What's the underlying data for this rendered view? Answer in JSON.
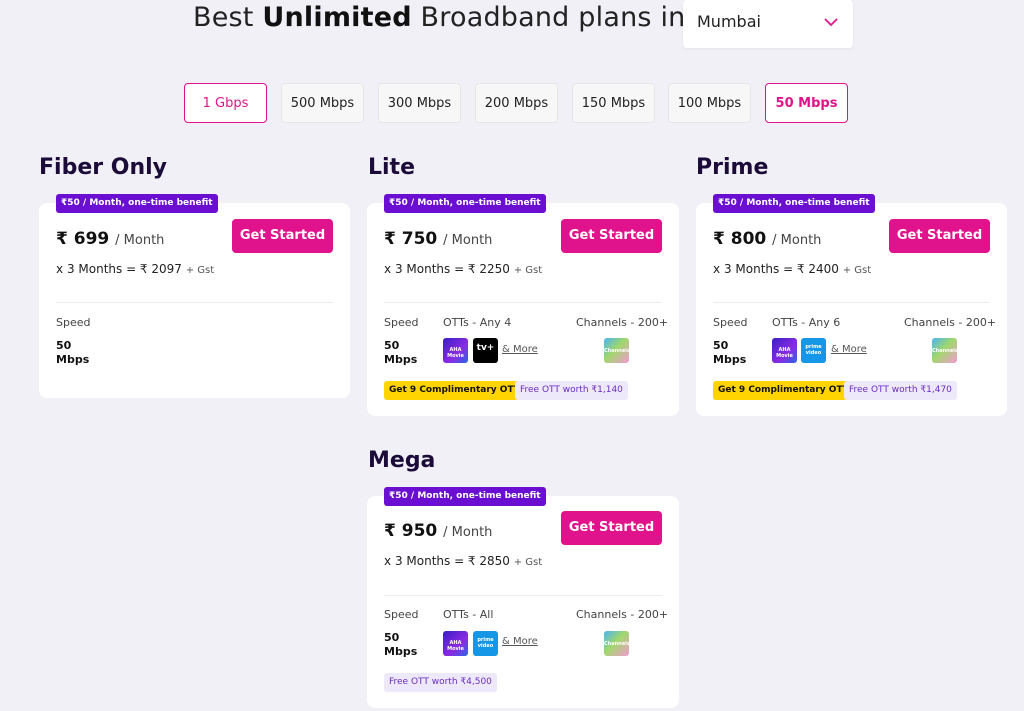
{
  "header": {
    "title_pre": "Best ",
    "title_bold": "Unlimited",
    "title_post": " Broadband plans in",
    "city": "Mumbai"
  },
  "speeds": [
    "1 Gbps",
    "500 Mbps",
    "300 Mbps",
    "200 Mbps",
    "150 Mbps",
    "100 Mbps",
    "50 Mbps"
  ],
  "selected_speed": "50 Mbps",
  "accent_color": "#e0138c",
  "benefit_color": "#6a0fd1",
  "plans": [
    {
      "name": "Fiber Only",
      "benefit": "₹50 / Month, one-time benefit",
      "price": "₹ 699",
      "per": "/ Month",
      "x": "x",
      "months": "3 Months = ₹ 2097",
      "gst": "+ Gst",
      "cta": "Get Started",
      "speed_label": "Speed",
      "speed_value": "50 Mbps"
    },
    {
      "name": "Lite",
      "benefit": "₹50 / Month, one-time benefit",
      "price": "₹ 750",
      "per": "/ Month",
      "x": "x",
      "months": "3 Months = ₹ 2250",
      "gst": "+ Gst",
      "cta": "Get Started",
      "speed_label": "Speed",
      "speed_value": "50 Mbps",
      "otts_label": "OTTs - Any 4",
      "channels_label": "Channels - 200+",
      "more": "& More",
      "ott_icons": [
        "aha-icon",
        "apple-tv-icon"
      ],
      "ott_icon_text": [
        "AHA Movie",
        "tv+"
      ],
      "channel_icon_text": "Channels",
      "pill_yellow": "Get 9 Complimentary OTTs",
      "pill_lilac": "Free OTT worth ₹1,140"
    },
    {
      "name": "Prime",
      "benefit": "₹50 / Month, one-time benefit",
      "price": "₹ 800",
      "per": "/ Month",
      "x": "x",
      "months": "3 Months = ₹ 2400",
      "gst": "+ Gst",
      "cta": "Get Started",
      "speed_label": "Speed",
      "speed_value": "50 Mbps",
      "otts_label": "OTTs - Any 6",
      "channels_label": "Channels - 200+",
      "more": "& More",
      "ott_icons": [
        "aha-icon",
        "prime-video-icon"
      ],
      "ott_icon_text": [
        "AHA Movie",
        "prime video"
      ],
      "channel_icon_text": "Channels",
      "pill_yellow": "Get 9 Complimentary OTTs",
      "pill_lilac": "Free OTT worth ₹1,470"
    },
    {
      "name": "Mega",
      "benefit": "₹50 / Month, one-time benefit",
      "price": "₹ 950",
      "per": "/ Month",
      "x": "x",
      "months": "3 Months = ₹ 2850",
      "gst": "+ Gst",
      "cta": "Get Started",
      "speed_label": "Speed",
      "speed_value": "50 Mbps",
      "otts_label": "OTTs - All",
      "channels_label": "Channels - 200+",
      "more": "& More",
      "ott_icons": [
        "aha-icon",
        "prime-video-icon"
      ],
      "ott_icon_text": [
        "AHA Movie",
        "prime video"
      ],
      "channel_icon_text": "Channels",
      "pill_lilac": "Free OTT worth ₹4,500"
    }
  ]
}
